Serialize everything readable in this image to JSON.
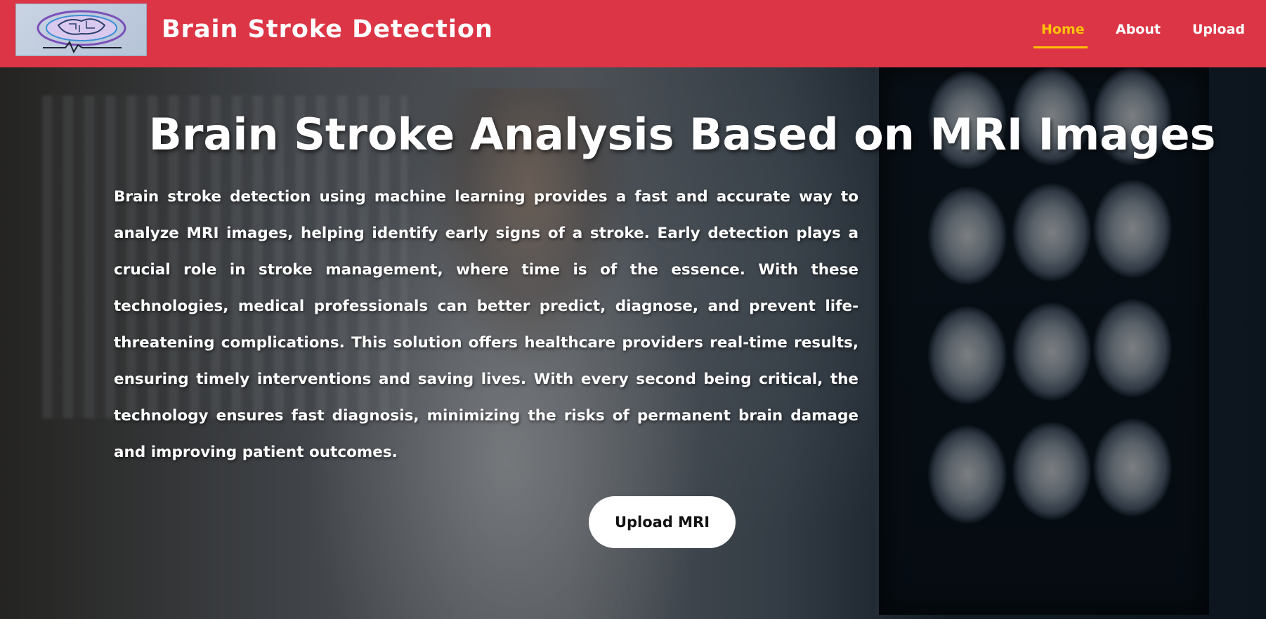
{
  "navbar": {
    "brand": "Brain Stroke Detection",
    "logo_icon": "brain-circuit-logo",
    "items": [
      {
        "label": "Home",
        "active": true
      },
      {
        "label": "About",
        "active": false
      },
      {
        "label": "Upload",
        "active": false
      }
    ],
    "bg_color": "#dc3545",
    "active_color": "#ffc107"
  },
  "hero": {
    "title": "Brain Stroke Analysis Based on MRI Images",
    "description": "Brain stroke detection using machine learning provides a fast and accurate way to analyze MRI images, helping identify early signs of a stroke. Early detection plays a crucial role in stroke management, where time is of the essence. With these technologies, medical professionals can better predict, diagnose, and prevent life-threatening complications. This solution offers healthcare providers real-time results, ensuring timely interventions and saving lives. With every second being critical, the technology ensures fast diagnosis, minimizing the risks of permanent brain damage and improving patient outcomes.",
    "cta_label": "Upload MRI",
    "background_image": "doctor-viewing-brain-mri-scans"
  }
}
